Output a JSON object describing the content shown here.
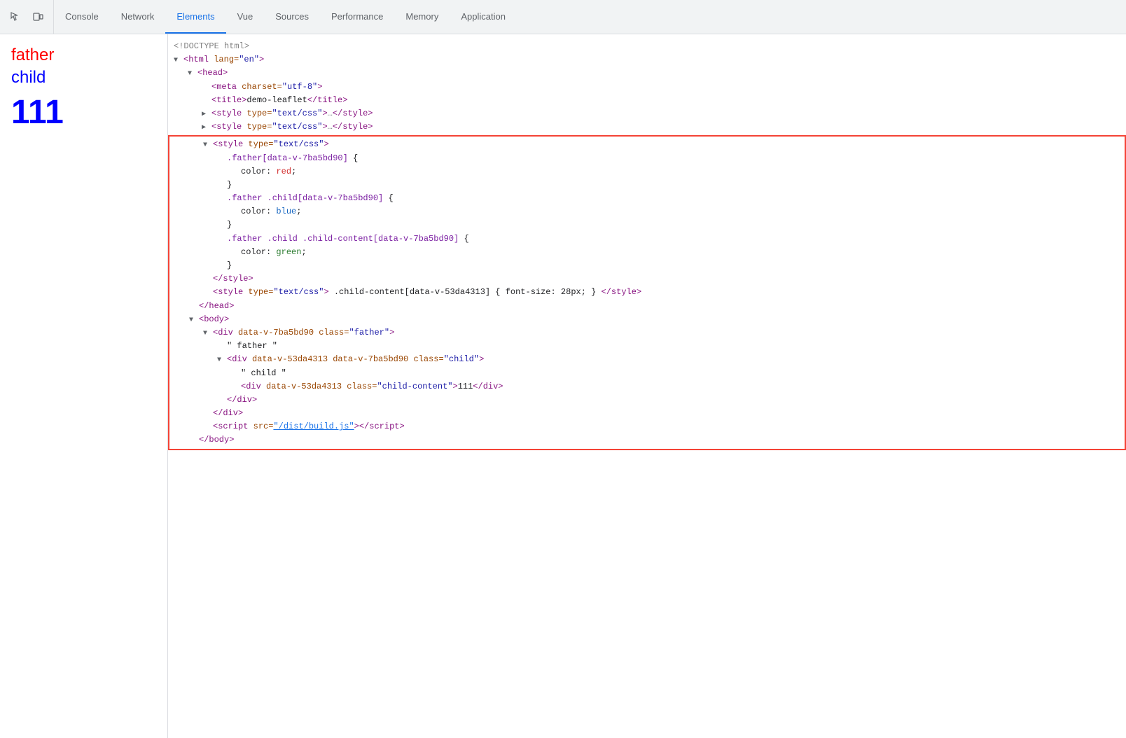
{
  "toolbar": {
    "tabs": [
      {
        "id": "console",
        "label": "Console",
        "active": false
      },
      {
        "id": "network",
        "label": "Network",
        "active": false
      },
      {
        "id": "elements",
        "label": "Elements",
        "active": true
      },
      {
        "id": "vue",
        "label": "Vue",
        "active": false
      },
      {
        "id": "sources",
        "label": "Sources",
        "active": false
      },
      {
        "id": "performance",
        "label": "Performance",
        "active": false
      },
      {
        "id": "memory",
        "label": "Memory",
        "active": false
      },
      {
        "id": "application",
        "label": "Application",
        "active": false
      }
    ]
  },
  "preview": {
    "father": "father",
    "child": "child",
    "number": "111"
  },
  "code": {
    "doctype": "<!DOCTYPE html>",
    "html_open": "<html lang=\"en\">",
    "head_open": "▼ <head>",
    "meta": "<meta charset=\"utf-8\">",
    "title": "<title>demo-leaflet</title>",
    "style1": "▶ <style type=\"text/css\">…</style>",
    "style2": "▶ <style type=\"text/css\">…</style>",
    "style3_open": "▼ <style type=\"text/css\">",
    "rule1_sel": ".father[data-v-7ba5bd90] {",
    "rule1_prop": "color: red;",
    "rule1_close": "}",
    "rule2_sel": ".father .child[data-v-7ba5bd90] {",
    "rule2_prop": "color: blue;",
    "rule2_close": "}",
    "rule3_sel": ".father .child .child-content[data-v-7ba5bd90] {",
    "rule3_prop": "color: green;",
    "rule3_close": "}",
    "style3_close": "</style>",
    "style4": "<style type=\"text/css\"> .child-content[data-v-53da4313] { font-size: 28px; } </style>",
    "head_close": "</head>",
    "body_open": "▼ <body>",
    "div_father_open": "▼ <div data-v-7ba5bd90 class=\"father\">",
    "father_text": "\" father \"",
    "div_child_open": "▼ <div data-v-53da4313 data-v-7ba5bd90 class=\"child\">",
    "child_text": "\" child \"",
    "div_content": "<div data-v-53da4313 class=\"child-content\">111</div>",
    "div_child_close": "</div>",
    "div_father_close": "</div>",
    "script_tag": "<script src=\"/dist/build.js\"></script>",
    "body_close": "</body>"
  }
}
